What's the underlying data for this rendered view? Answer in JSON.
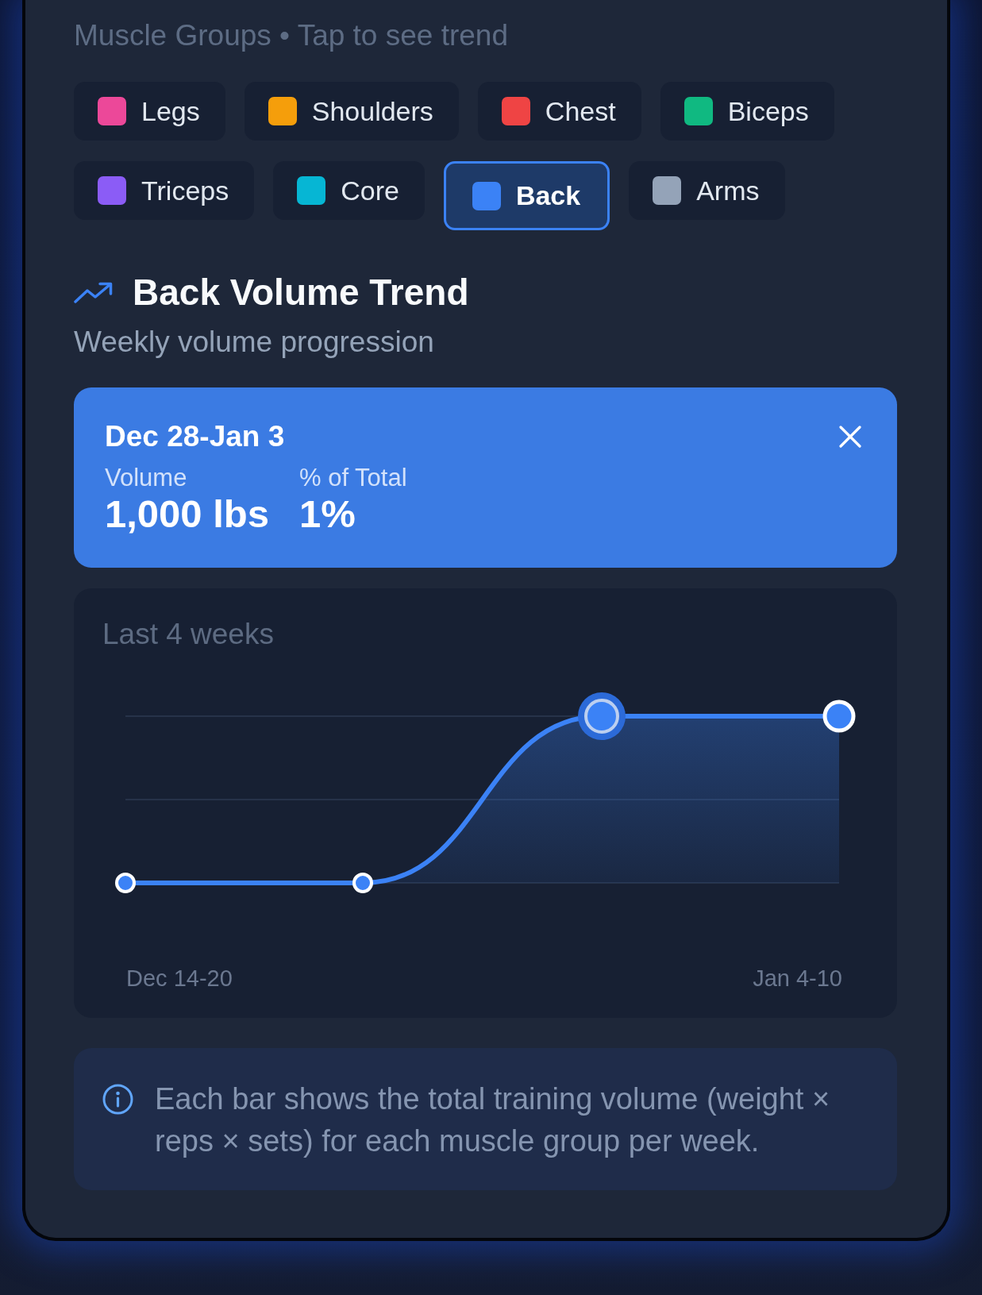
{
  "header": {
    "subtitle": "Muscle Groups • Tap to see trend"
  },
  "muscle_groups": [
    {
      "label": "Legs",
      "color": "#ec4899",
      "selected": false
    },
    {
      "label": "Shoulders",
      "color": "#f59e0b",
      "selected": false
    },
    {
      "label": "Chest",
      "color": "#ef4444",
      "selected": false
    },
    {
      "label": "Biceps",
      "color": "#10b981",
      "selected": false
    },
    {
      "label": "Triceps",
      "color": "#8b5cf6",
      "selected": false
    },
    {
      "label": "Core",
      "color": "#06b6d4",
      "selected": false
    },
    {
      "label": "Back",
      "color": "#3b82f6",
      "selected": true
    },
    {
      "label": "Arms",
      "color": "#94a3b8",
      "selected": false
    }
  ],
  "trend": {
    "title": "Back Volume Trend",
    "subtitle": "Weekly volume progression"
  },
  "tooltip": {
    "period": "Dec 28-Jan 3",
    "stats": [
      {
        "label": "Volume",
        "value": "1,000 lbs"
      },
      {
        "label": "% of Total",
        "value": "1%"
      }
    ]
  },
  "chart": {
    "title": "Last 4 weeks",
    "x_labels": [
      "Dec 14-20",
      "Jan 4-10"
    ],
    "points": [
      {
        "selected": false
      },
      {
        "selected": false
      },
      {
        "selected": true
      },
      {
        "selected": false
      }
    ]
  },
  "info": {
    "text": "Each bar shows the total training volume (weight × reps × sets) for each muscle group per week."
  }
}
